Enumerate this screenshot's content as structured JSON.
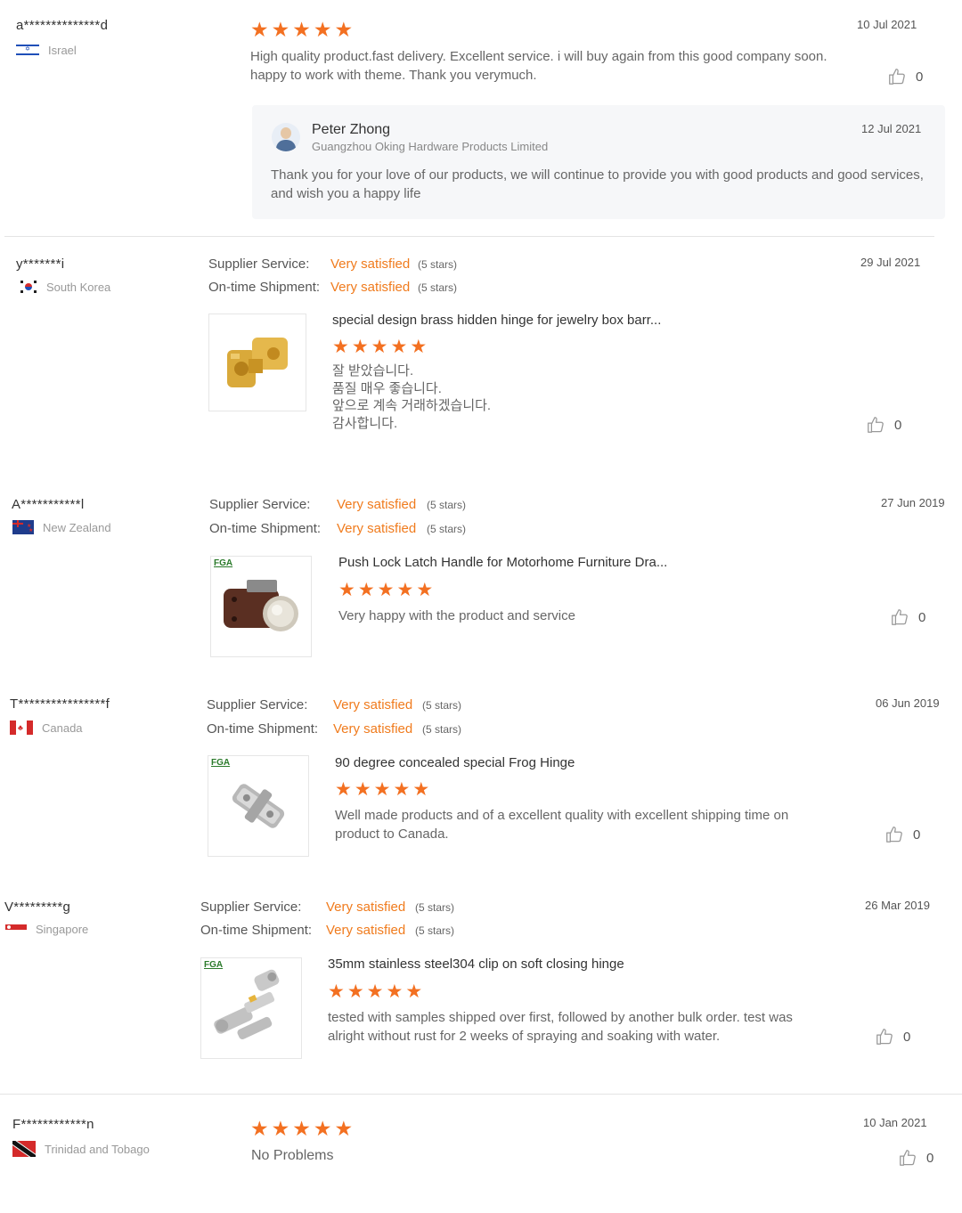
{
  "reviews": [
    {
      "user": "a**************d",
      "country": "Israel",
      "date": "10 Jul 2021",
      "text": "High quality product.fast delivery. Excellent service. i will buy again from this good company soon. happy to work with theme. Thank you verymuch.",
      "likes": "0",
      "reply": {
        "name": "Peter Zhong",
        "company": "Guangzhou Oking Hardware Products Limited",
        "date": "12 Jul 2021",
        "text": "Thank you for your love of our products, we will continue to provide you with good products and good services, and wish you a happy life"
      }
    },
    {
      "user": "y*******i",
      "country": "South Korea",
      "date": "29 Jul 2021",
      "supplier_label": "Supplier Service:",
      "supplier_value": "Very satisfied",
      "supplier_note": "(5 stars)",
      "shipment_label": "On-time Shipment:",
      "shipment_value": "Very satisfied",
      "shipment_note": "(5 stars)",
      "product": "special design brass hidden hinge for jewelry box barr...",
      "text_lines": [
        "잘 받았습니다.",
        "품질 매우 좋습니다.",
        "앞으로 계속 거래하겠습니다.",
        "감사합니다."
      ],
      "likes": "0"
    },
    {
      "user": "A***********l",
      "country": "New Zealand",
      "date": "27 Jun 2019",
      "supplier_label": "Supplier Service:",
      "supplier_value": "Very satisfied",
      "supplier_note": "(5 stars)",
      "shipment_label": "On-time Shipment:",
      "shipment_value": "Very satisfied",
      "shipment_note": "(5 stars)",
      "product": "Push Lock Latch Handle for Motorhome Furniture Dra...",
      "text": "Very happy with the product and service",
      "logo": "FGA",
      "likes": "0"
    },
    {
      "user": "T****************f",
      "country": "Canada",
      "date": "06 Jun 2019",
      "supplier_label": "Supplier Service:",
      "supplier_value": "Very satisfied",
      "supplier_note": "(5 stars)",
      "shipment_label": "On-time Shipment:",
      "shipment_value": "Very satisfied",
      "shipment_note": "(5 stars)",
      "product": "90 degree concealed special Frog Hinge",
      "text": "Well made products and of a excellent quality with excellent shipping time on product to Canada.",
      "logo": "FGA",
      "likes": "0"
    },
    {
      "user": "V*********g",
      "country": "Singapore",
      "date": "26 Mar 2019",
      "supplier_label": "Supplier Service:",
      "supplier_value": "Very satisfied",
      "supplier_note": "(5 stars)",
      "shipment_label": "On-time Shipment:",
      "shipment_value": "Very satisfied",
      "shipment_note": "(5 stars)",
      "product": "35mm stainless steel304 clip on soft closing hinge",
      "text": "tested with samples shipped over first, followed by another bulk order. test was alright without rust for 2 weeks of spraying and soaking with water.",
      "logo": "FGA",
      "likes": "0"
    },
    {
      "user": "F************n",
      "country": "Trinidad and Tobago",
      "date": "10 Jan 2021",
      "text": "No Problems",
      "likes": "0"
    }
  ],
  "colors": {
    "star": "#f37021",
    "satisfied": "#f07b1d"
  },
  "icons": {
    "star": "star-icon",
    "like": "thumbs-up-icon"
  }
}
